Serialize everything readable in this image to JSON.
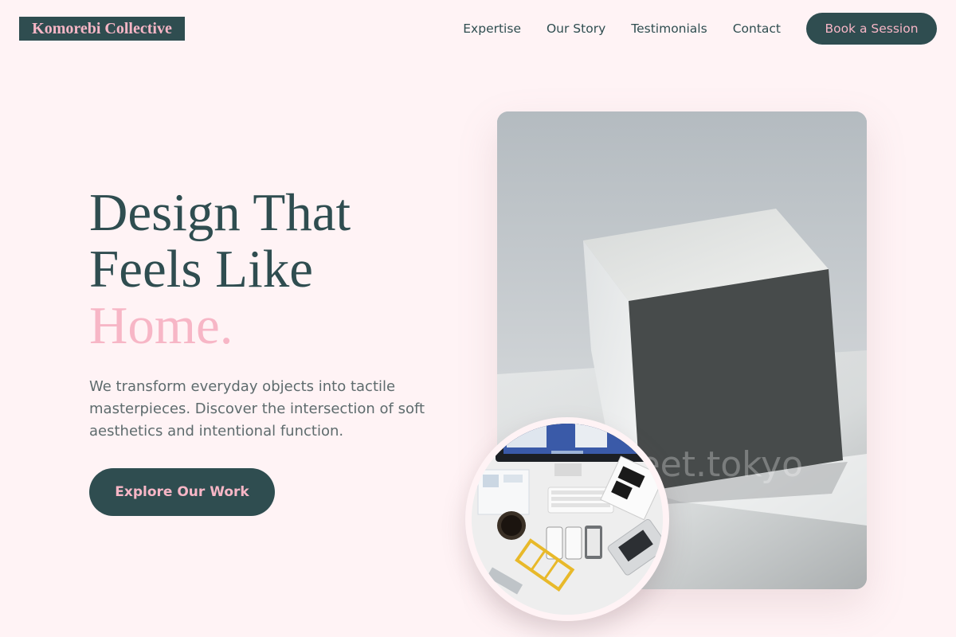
{
  "brand": {
    "name": "Komorebi Collective"
  },
  "nav": {
    "links": [
      "Expertise",
      "Our Story",
      "Testimonials",
      "Contact"
    ],
    "cta_label": "Book a Session"
  },
  "hero": {
    "headline_line1": "Design That",
    "headline_line2": "Feels Like",
    "headline_accent": "Home.",
    "subtext": "We transform everyday objects into tactile masterpieces. Discover the intersection of soft aesthetics and intentional function.",
    "cta_label": "Explore Our Work"
  },
  "image": {
    "watermark": "lorikeet.tokyo"
  },
  "colors": {
    "background": "#fff3f5",
    "primary": "#2f4d50",
    "accent": "#f7b6c6"
  }
}
